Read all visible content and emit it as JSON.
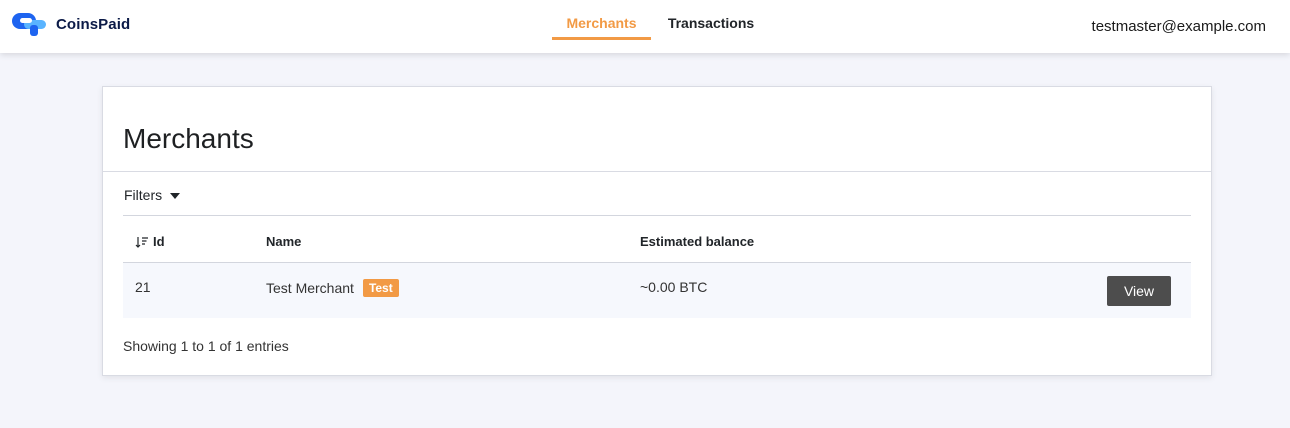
{
  "header": {
    "brand": "CoinsPaid",
    "nav": [
      {
        "label": "Merchants",
        "active": true
      },
      {
        "label": "Transactions",
        "active": false
      }
    ],
    "user_email": "testmaster@example.com"
  },
  "colors": {
    "accent": "#f29a45",
    "logo_blue": "#1e64f0",
    "logo_light": "#5ab4ff",
    "button_dark": "#4d4d4d"
  },
  "page": {
    "title": "Merchants",
    "filters_label": "Filters",
    "table": {
      "columns": [
        "Id",
        "Name",
        "Estimated balance"
      ],
      "rows": [
        {
          "id": "21",
          "name": "Test Merchant",
          "badge": "Test",
          "balance": "~0.00 BTC",
          "action": "View"
        }
      ]
    },
    "entries_text": "Showing 1 to 1 of 1 entries"
  },
  "icons": [
    "coinspaid-logo",
    "sort-icon",
    "caret-down-icon"
  ]
}
